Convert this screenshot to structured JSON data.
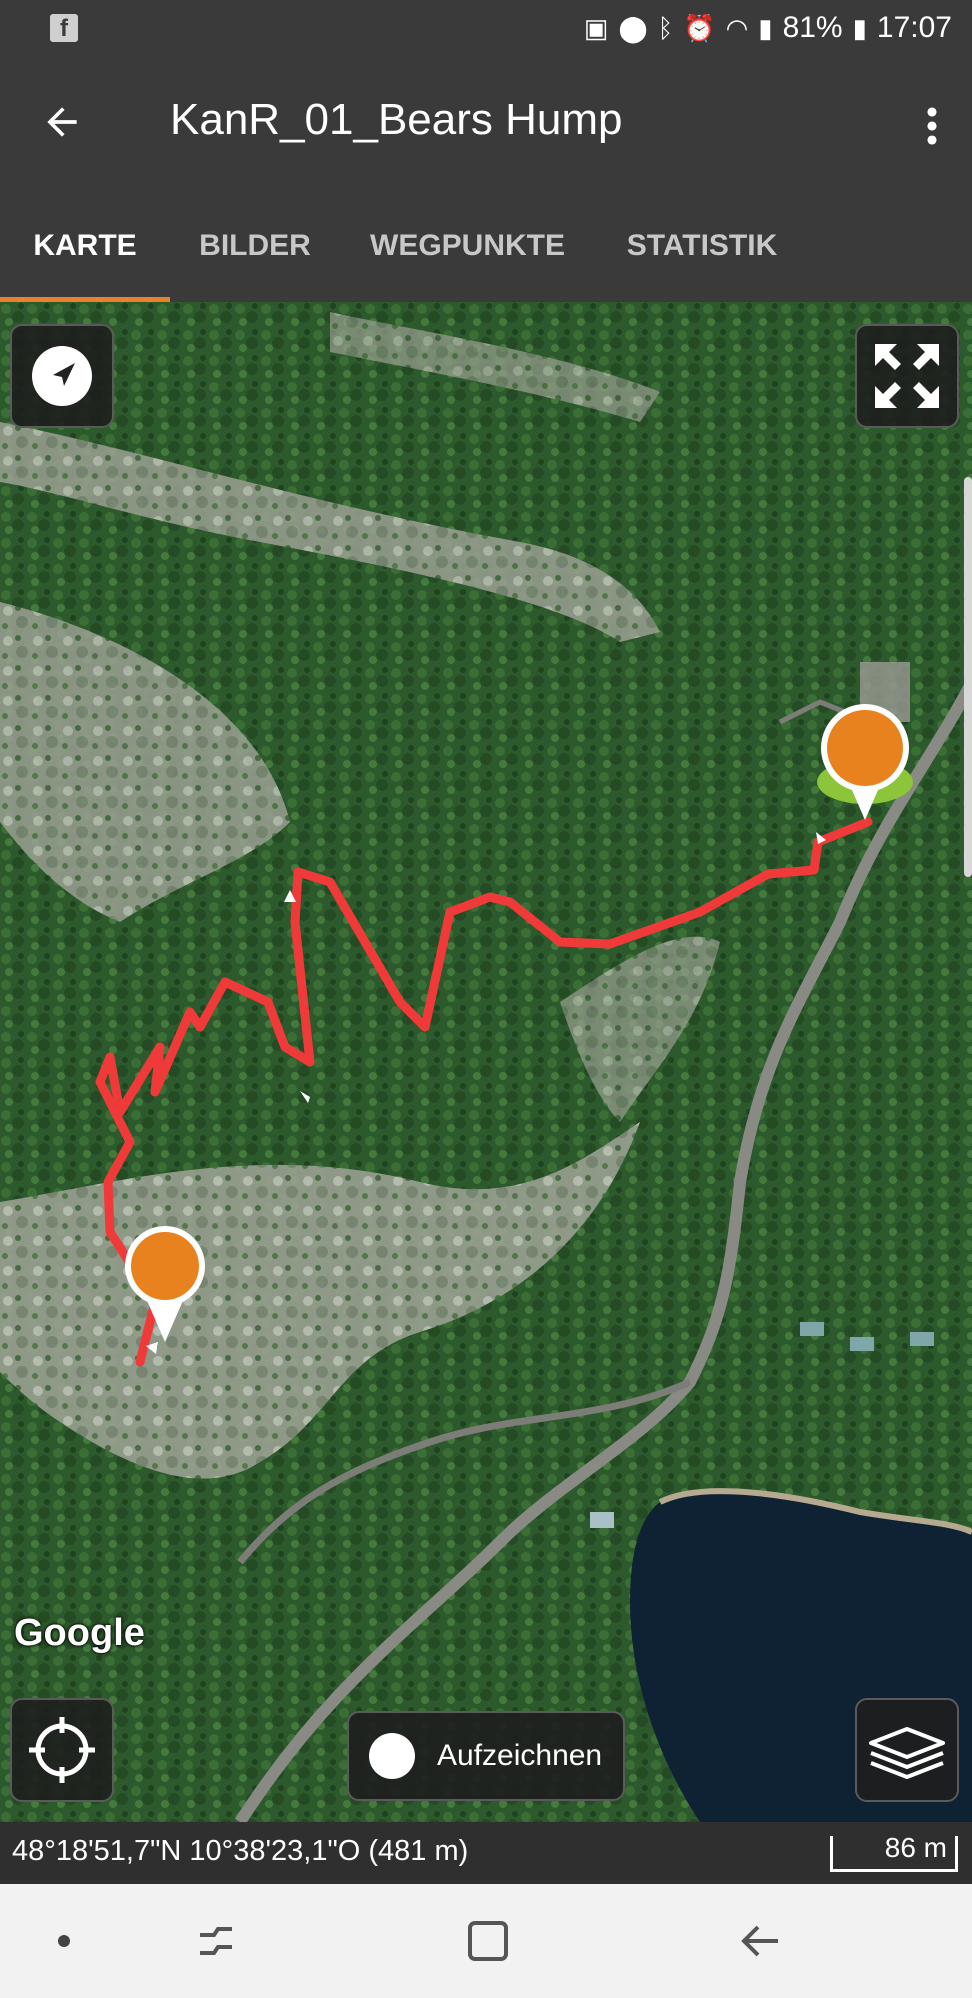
{
  "status_bar": {
    "battery_percent": "81%",
    "time": "17:07",
    "icons": [
      "facebook-icon",
      "battery-saver-icon",
      "location-icon",
      "bluetooth-icon",
      "alarm-icon",
      "wifi-icon",
      "signal-icon",
      "battery-icon"
    ]
  },
  "app_bar": {
    "title": "KanR_01_Bears Hump",
    "back_icon": "arrow-left-icon",
    "menu_icon": "more-vert-icon"
  },
  "tabs": [
    {
      "label": "KARTE",
      "active": true
    },
    {
      "label": "BILDER",
      "active": false
    },
    {
      "label": "WEGPUNKTE",
      "active": false
    },
    {
      "label": "STATISTIK",
      "active": false
    }
  ],
  "map": {
    "attribution": "Google",
    "record_button_label": "Aufzeichnen",
    "route_color": "#f03a3a",
    "marker_color": "#e8821e",
    "start_marker_color": "#8cc43a",
    "buttons": [
      "compass-icon",
      "fullscreen-icon",
      "my-location-icon",
      "layers-icon"
    ]
  },
  "footer": {
    "coordinates": "48°18'51,7\"N 10°38'23,1\"O (481 m)",
    "scale": "86 m"
  },
  "colors": {
    "toolbar": "#3a3a3a",
    "accent": "#e8822b"
  }
}
